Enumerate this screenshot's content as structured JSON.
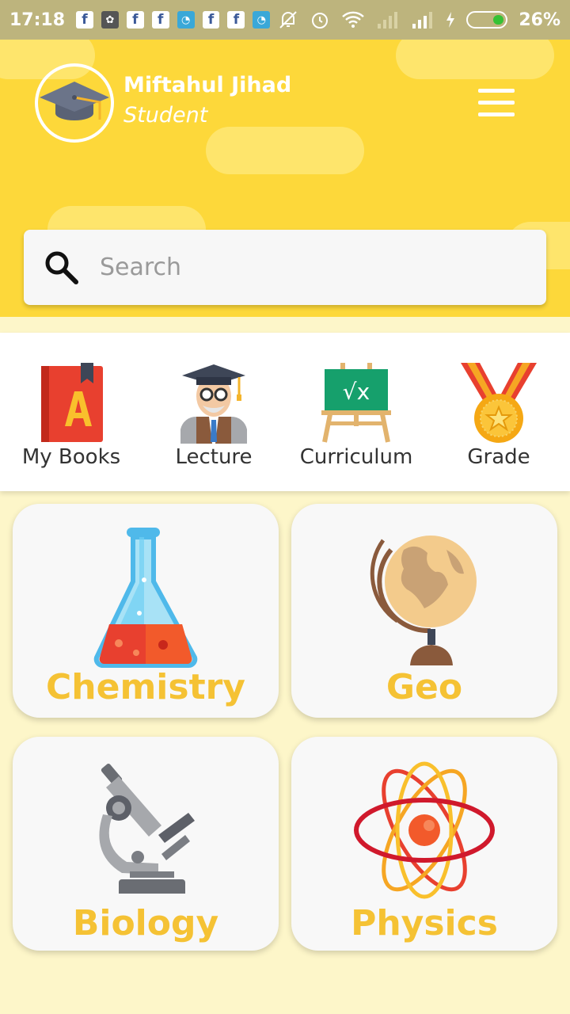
{
  "status_bar": {
    "time": "17:18",
    "battery": "26%",
    "notification_icons": [
      "facebook-icon",
      "app-icon",
      "facebook-icon",
      "facebook-icon",
      "app-icon",
      "facebook-icon",
      "facebook-icon",
      "app-icon"
    ]
  },
  "profile": {
    "name": "Miftahul Jihad",
    "role": "Student"
  },
  "search": {
    "placeholder": "Search"
  },
  "quick_nav": [
    {
      "label": "My Books",
      "icon": "book-icon"
    },
    {
      "label": "Lecture",
      "icon": "professor-icon"
    },
    {
      "label": "Curriculum",
      "icon": "chalkboard-icon"
    },
    {
      "label": "Grade",
      "icon": "medal-icon"
    }
  ],
  "subjects": [
    {
      "label": "Chemistry",
      "icon": "flask-icon"
    },
    {
      "label": "Geo",
      "icon": "globe-icon"
    },
    {
      "label": "Biology",
      "icon": "microscope-icon"
    },
    {
      "label": "Physics",
      "icon": "atom-icon"
    }
  ],
  "colors": {
    "header": "#fdd83a",
    "background": "#fdf6c9",
    "subject_label": "#f5c234"
  }
}
